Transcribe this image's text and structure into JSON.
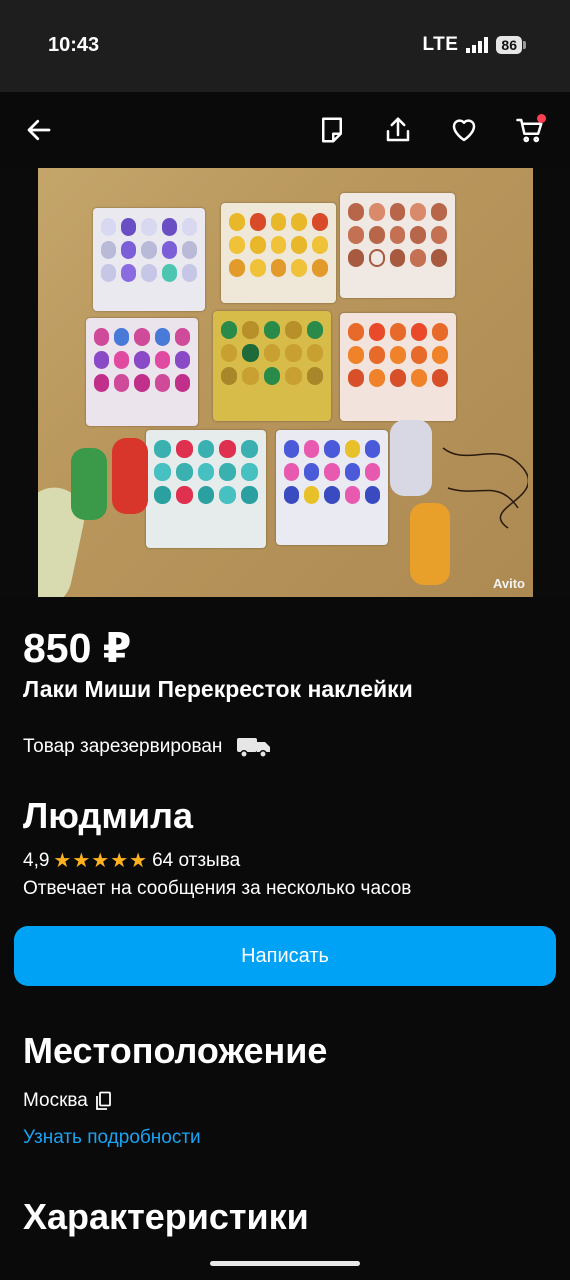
{
  "status": {
    "time": "10:43",
    "network": "LTE",
    "battery": "86"
  },
  "toolbar": {
    "back_icon": "arrow-left-icon",
    "note_icon": "note-icon",
    "share_icon": "share-icon",
    "favorite_icon": "heart-icon",
    "cart_icon": "cart-icon"
  },
  "photo": {
    "watermark": "Avito"
  },
  "listing": {
    "price": "850 ₽",
    "title": "Лаки Миши Перекресток наклейки",
    "status": "Товар зарезервирован",
    "status_icon": "truck-icon"
  },
  "seller": {
    "name": "Людмила",
    "rating": "4,9",
    "stars": "★★★★★",
    "reviews": "64 отзыва",
    "response": "Отвечает на сообщения за несколько часов",
    "write_button": "Написать"
  },
  "location": {
    "heading": "Местоположение",
    "city": "Москва",
    "copy_icon": "copy-icon",
    "details_link": "Узнать подробности"
  },
  "characteristics": {
    "heading": "Характеристики"
  },
  "colors": {
    "accent": "#00a2f5",
    "link": "#1aa3f3",
    "star": "#ffb21e",
    "badge": "#ff4053"
  }
}
